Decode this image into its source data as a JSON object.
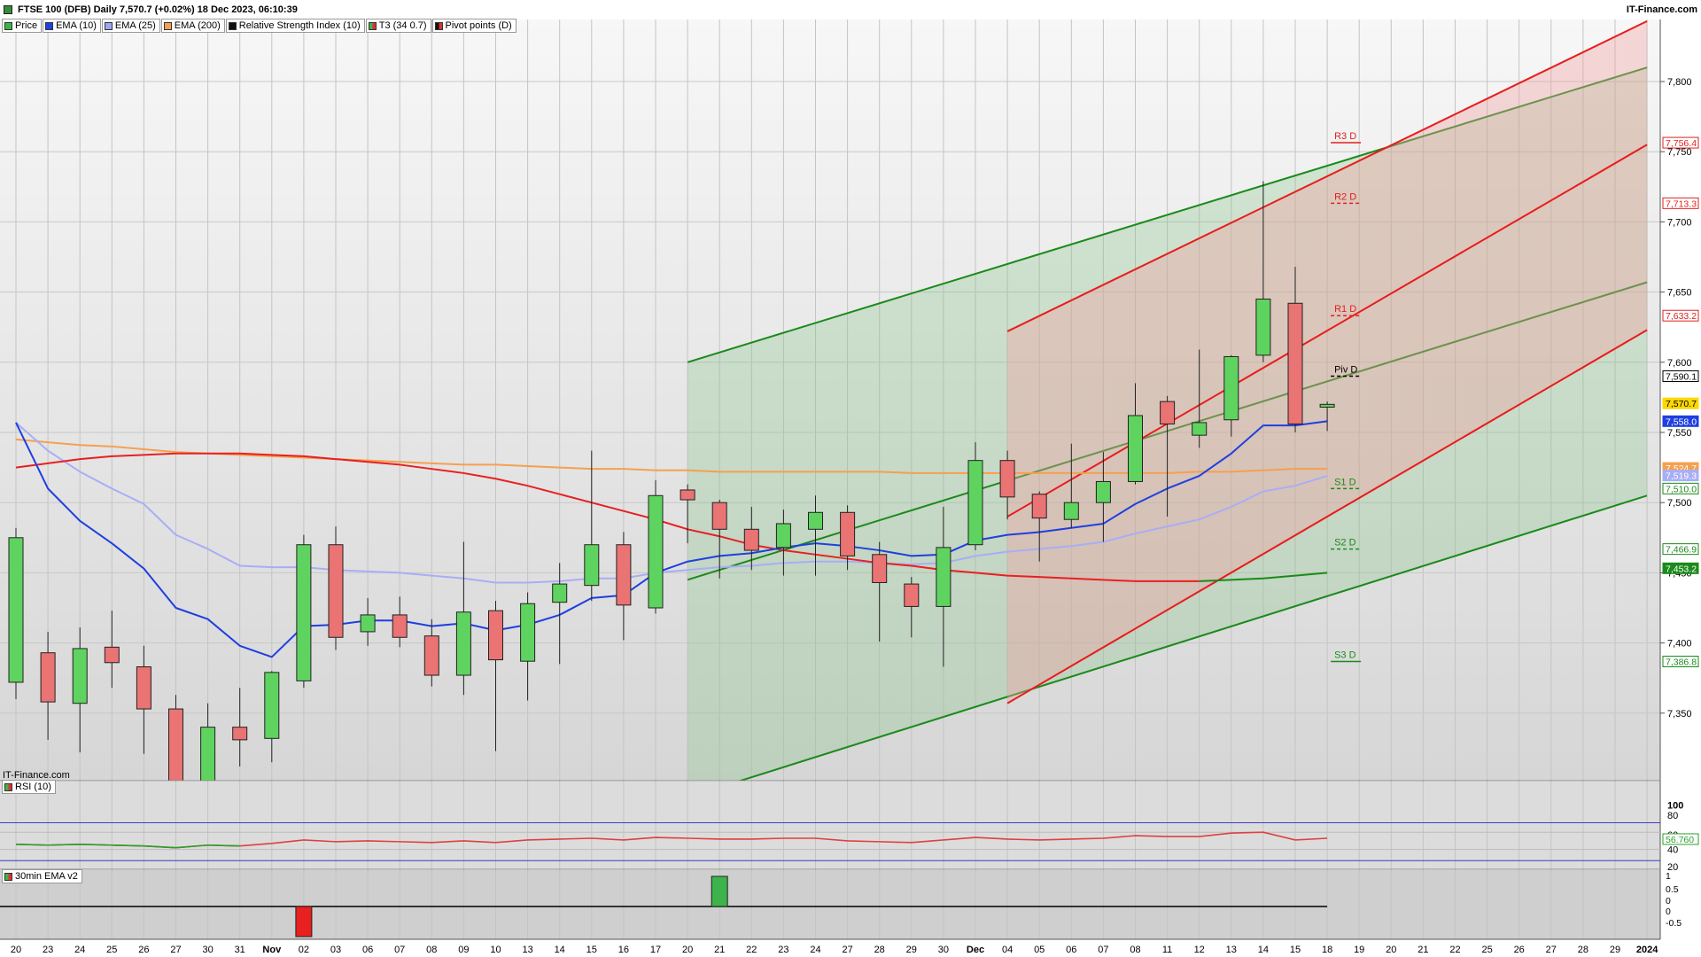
{
  "header": {
    "title": "FTSE 100 (DFB) Daily 7,570.7 (+0.02%) 18 Dec 2023, 06:10:39",
    "brand": "IT-Finance.com",
    "watermark": "IT-Finance.com"
  },
  "legend": [
    {
      "label": "Price",
      "color": "#3cb44b"
    },
    {
      "label": "EMA (10)",
      "color": "#1f3fe0"
    },
    {
      "label": "EMA (25)",
      "color": "#9ba6f5"
    },
    {
      "label": "EMA (200)",
      "color": "#f5a050"
    },
    {
      "label": "Relative Strength Index (10)",
      "color": "#111111"
    },
    {
      "label": "T3 (34 0.7)",
      "color": "#e03030"
    },
    {
      "label": "Pivot points (D)",
      "color": "#111111"
    }
  ],
  "colors": {
    "up": "#5fd35f",
    "down": "#ea7373",
    "ema10": "#1f3fe0",
    "ema25": "#a8aef5",
    "ema200": "#f5a050",
    "t3": "#e82020",
    "rsi": "#e04040",
    "channel_green": "#1a8a1a",
    "channel_red": "#e81c1c"
  },
  "rsi_panel": {
    "label": "RSI (10)",
    "ticks": [
      "100",
      "80",
      "60",
      "40",
      "20"
    ],
    "current": "56.760"
  },
  "indicator_panel": {
    "label": "30min EMA v2",
    "ticks": [
      "1",
      "0.5",
      "0",
      "0",
      "-0.5"
    ]
  },
  "chart_data": {
    "type": "candlestick",
    "title": "FTSE 100 (DFB) Daily",
    "ylim": [
      7290,
      7850
    ],
    "y_ticks": [
      7350,
      7400,
      7450,
      7500,
      7550,
      7600,
      7650,
      7700,
      7750,
      7800
    ],
    "y_tick_labels": [
      "7,350",
      "7,400",
      "7,450",
      "7,500",
      "7,550",
      "7,600",
      "7,650",
      "7,700",
      "7,750",
      "7,800"
    ],
    "x_labels": [
      "20",
      "23",
      "24",
      "25",
      "26",
      "27",
      "30",
      "31",
      "Nov",
      "02",
      "03",
      "06",
      "07",
      "08",
      "09",
      "10",
      "13",
      "14",
      "15",
      "16",
      "17",
      "20",
      "21",
      "22",
      "23",
      "24",
      "27",
      "28",
      "29",
      "30",
      "Dec",
      "04",
      "05",
      "06",
      "07",
      "08",
      "11",
      "12",
      "13",
      "14",
      "15",
      "18",
      "19",
      "20",
      "21",
      "22",
      "25",
      "26",
      "27",
      "28",
      "29",
      "2024"
    ],
    "candles": [
      {
        "o": 7372,
        "h": 7482,
        "l": 7360,
        "c": 7475
      },
      {
        "o": 7393,
        "h": 7408,
        "l": 7331,
        "c": 7358
      },
      {
        "o": 7357,
        "h": 7411,
        "l": 7322,
        "c": 7396
      },
      {
        "o": 7397,
        "h": 7423,
        "l": 7368,
        "c": 7386
      },
      {
        "o": 7383,
        "h": 7398,
        "l": 7321,
        "c": 7353
      },
      {
        "o": 7353,
        "h": 7363,
        "l": 7290,
        "c": 7292
      },
      {
        "o": 7290,
        "h": 7357,
        "l": 7285,
        "c": 7340
      },
      {
        "o": 7340,
        "h": 7368,
        "l": 7312,
        "c": 7331
      },
      {
        "o": 7332,
        "h": 7380,
        "l": 7315,
        "c": 7379
      },
      {
        "o": 7373,
        "h": 7477,
        "l": 7368,
        "c": 7470
      },
      {
        "o": 7470,
        "h": 7483,
        "l": 7395,
        "c": 7404
      },
      {
        "o": 7408,
        "h": 7432,
        "l": 7398,
        "c": 7420
      },
      {
        "o": 7420,
        "h": 7433,
        "l": 7397,
        "c": 7404
      },
      {
        "o": 7405,
        "h": 7417,
        "l": 7369,
        "c": 7377
      },
      {
        "o": 7377,
        "h": 7472,
        "l": 7363,
        "c": 7422
      },
      {
        "o": 7423,
        "h": 7430,
        "l": 7323,
        "c": 7388
      },
      {
        "o": 7387,
        "h": 7436,
        "l": 7359,
        "c": 7428
      },
      {
        "o": 7429,
        "h": 7457,
        "l": 7385,
        "c": 7442
      },
      {
        "o": 7441,
        "h": 7537,
        "l": 7430,
        "c": 7470
      },
      {
        "o": 7470,
        "h": 7479,
        "l": 7402,
        "c": 7427
      },
      {
        "o": 7425,
        "h": 7516,
        "l": 7421,
        "c": 7505
      },
      {
        "o": 7509,
        "h": 7513,
        "l": 7471,
        "c": 7502
      },
      {
        "o": 7500,
        "h": 7502,
        "l": 7446,
        "c": 7481
      },
      {
        "o": 7481,
        "h": 7497,
        "l": 7452,
        "c": 7466
      },
      {
        "o": 7468,
        "h": 7495,
        "l": 7448,
        "c": 7485
      },
      {
        "o": 7481,
        "h": 7505,
        "l": 7448,
        "c": 7493
      },
      {
        "o": 7493,
        "h": 7498,
        "l": 7452,
        "c": 7462
      },
      {
        "o": 7463,
        "h": 7472,
        "l": 7401,
        "c": 7443
      },
      {
        "o": 7442,
        "h": 7447,
        "l": 7404,
        "c": 7426
      },
      {
        "o": 7426,
        "h": 7497,
        "l": 7383,
        "c": 7468
      },
      {
        "o": 7470,
        "h": 7543,
        "l": 7466,
        "c": 7530
      },
      {
        "o": 7530,
        "h": 7537,
        "l": 7488,
        "c": 7504
      },
      {
        "o": 7506,
        "h": 7508,
        "l": 7458,
        "c": 7489
      },
      {
        "o": 7488,
        "h": 7542,
        "l": 7482,
        "c": 7500
      },
      {
        "o": 7500,
        "h": 7536,
        "l": 7472,
        "c": 7515
      },
      {
        "o": 7515,
        "h": 7585,
        "l": 7513,
        "c": 7562
      },
      {
        "o": 7572,
        "h": 7576,
        "l": 7490,
        "c": 7556
      },
      {
        "o": 7548,
        "h": 7609,
        "l": 7539,
        "c": 7557
      },
      {
        "o": 7559,
        "h": 7605,
        "l": 7547,
        "c": 7604
      },
      {
        "o": 7605,
        "h": 7729,
        "l": 7600,
        "c": 7645
      },
      {
        "o": 7642,
        "h": 7668,
        "l": 7550,
        "c": 7556
      },
      {
        "o": 7568,
        "h": 7572,
        "l": 7551,
        "c": 7570
      }
    ],
    "ema10": [
      7557,
      7510,
      7487,
      7471,
      7453,
      7425,
      7417,
      7398,
      7390,
      7412,
      7413,
      7416,
      7416,
      7412,
      7414,
      7409,
      7413,
      7420,
      7432,
      7434,
      7450,
      7458,
      7462,
      7464,
      7468,
      7471,
      7469,
      7466,
      7462,
      7463,
      7473,
      7477,
      7479,
      7482,
      7485,
      7499,
      7510,
      7519,
      7535,
      7555,
      7555,
      7558
    ],
    "ema25": [
      7557,
      7537,
      7522,
      7510,
      7499,
      7477,
      7467,
      7455,
      7454,
      7454,
      7452,
      7451,
      7450,
      7448,
      7446,
      7443,
      7443,
      7444,
      7446,
      7446,
      7450,
      7452,
      7454,
      7455,
      7457,
      7458,
      7458,
      7457,
      7456,
      7457,
      7462,
      7465,
      7467,
      7469,
      7472,
      7478,
      7483,
      7488,
      7497,
      7508,
      7512,
      7519
    ],
    "ema200": [
      7545,
      7543,
      7541,
      7540,
      7538,
      7536,
      7535,
      7534,
      7533,
      7532,
      7531,
      7530,
      7529,
      7528,
      7527,
      7527,
      7526,
      7525,
      7524,
      7524,
      7523,
      7523,
      7522,
      7522,
      7522,
      7522,
      7522,
      7522,
      7521,
      7521,
      7521,
      7521,
      7521,
      7521,
      7521,
      7521,
      7521,
      7522,
      7522,
      7523,
      7524,
      7524
    ],
    "t3": [
      7525,
      7528,
      7531,
      7533,
      7534,
      7535,
      7535,
      7535,
      7534,
      7533,
      7531,
      7529,
      7527,
      7524,
      7521,
      7517,
      7512,
      7506,
      7500,
      7494,
      7488,
      7481,
      7476,
      7470,
      7466,
      7463,
      7460,
      7457,
      7455,
      7452,
      7450,
      7448,
      7447,
      7446,
      7445,
      7444,
      7444,
      7444,
      7445,
      7446,
      7448,
      7450
    ],
    "t3_green_from": 37,
    "pivots": {
      "R3 D": {
        "value": 7756.4,
        "label": "7,756.4"
      },
      "R2 D": {
        "value": 7713.3,
        "label": "7,713.3"
      },
      "R1 D": {
        "value": 7633.2,
        "label": "7,633.2"
      },
      "Piv D": {
        "value": 7590.1,
        "label": "7,590.1"
      },
      "S1 D": {
        "value": 7510.0,
        "label": "7,510.0"
      },
      "S2 D": {
        "value": 7466.9,
        "label": "7,466.9"
      },
      "S3 D": {
        "value": 7386.8,
        "label": "7,386.8"
      }
    },
    "price_tags": [
      {
        "value": 7570.7,
        "label": "7,570.7",
        "bg": "#ffd700",
        "fg": "#000"
      },
      {
        "value": 7558.0,
        "label": "7,558.0",
        "bg": "#1f3fe0",
        "fg": "#fff"
      },
      {
        "value": 7524.7,
        "label": "7,524.7",
        "bg": "#f5a050",
        "fg": "#fff"
      },
      {
        "value": 7519.3,
        "label": "7,519.3",
        "bg": "#a8aef5",
        "fg": "#fff"
      },
      {
        "value": 7453.2,
        "label": "7,453.2",
        "bg": "#1a8a1a",
        "fg": "#fff"
      }
    ],
    "green_channel": {
      "from": 21,
      "to": 51,
      "upper": [
        7600,
        7810
      ],
      "mid": [
        7445,
        7657
      ],
      "lower": [
        7290,
        7505
      ]
    },
    "red_channel": {
      "from": 31,
      "to": 51,
      "upper": [
        7622,
        7843
      ],
      "mid": [
        7490,
        7755
      ],
      "lower": [
        7357,
        7623
      ]
    },
    "rsi": [
      46,
      45,
      46,
      45,
      44,
      42,
      45,
      44,
      47,
      51,
      49,
      50,
      49,
      48,
      50,
      48,
      51,
      52,
      53,
      51,
      54,
      53,
      52,
      52,
      53,
      53,
      50,
      49,
      48,
      51,
      54,
      52,
      51,
      52,
      53,
      56,
      55,
      55,
      59,
      60,
      51,
      53
    ],
    "indicator_bars": [
      {
        "index": 9,
        "value": -1
      },
      {
        "index": 22,
        "value": 1
      }
    ]
  }
}
